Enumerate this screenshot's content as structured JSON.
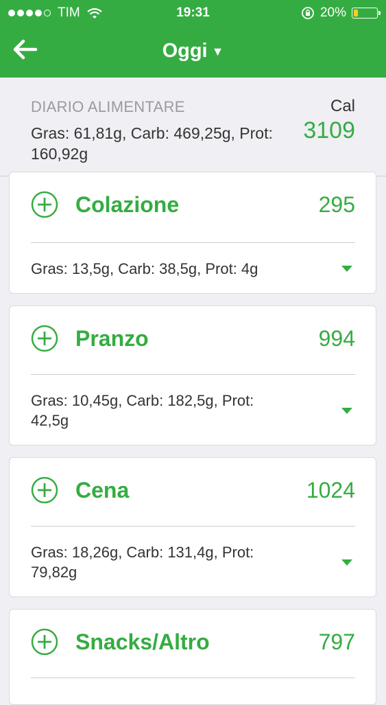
{
  "status": {
    "carrier": "TIM",
    "time": "19:31",
    "battery": "20%",
    "battery_level": 0.2
  },
  "nav": {
    "title": "Oggi"
  },
  "summary": {
    "label": "DIARIO ALIMENTARE",
    "macros": "Gras: 61,81g, Carb: 469,25g, Prot: 160,92g",
    "cal_label": "Cal",
    "cal_value": "3109"
  },
  "meals": [
    {
      "name": "Colazione",
      "kcal": "295",
      "macros": "Gras: 13,5g, Carb: 38,5g, Prot: 4g"
    },
    {
      "name": "Pranzo",
      "kcal": "994",
      "macros": "Gras: 10,45g, Carb: 182,5g, Prot: 42,5g"
    },
    {
      "name": "Cena",
      "kcal": "1024",
      "macros": "Gras: 18,26g, Carb: 131,4g, Prot: 79,82g"
    },
    {
      "name": "Snacks/Altro",
      "kcal": "797"
    }
  ],
  "colors": {
    "accent": "#35ac42",
    "background": "#efeff4",
    "battery_fill": "#f7d117"
  },
  "icons": {
    "back": "arrow-left-icon",
    "add": "plus-circle-icon",
    "expand": "caret-down-icon",
    "title_dropdown": "caret-down-icon"
  }
}
